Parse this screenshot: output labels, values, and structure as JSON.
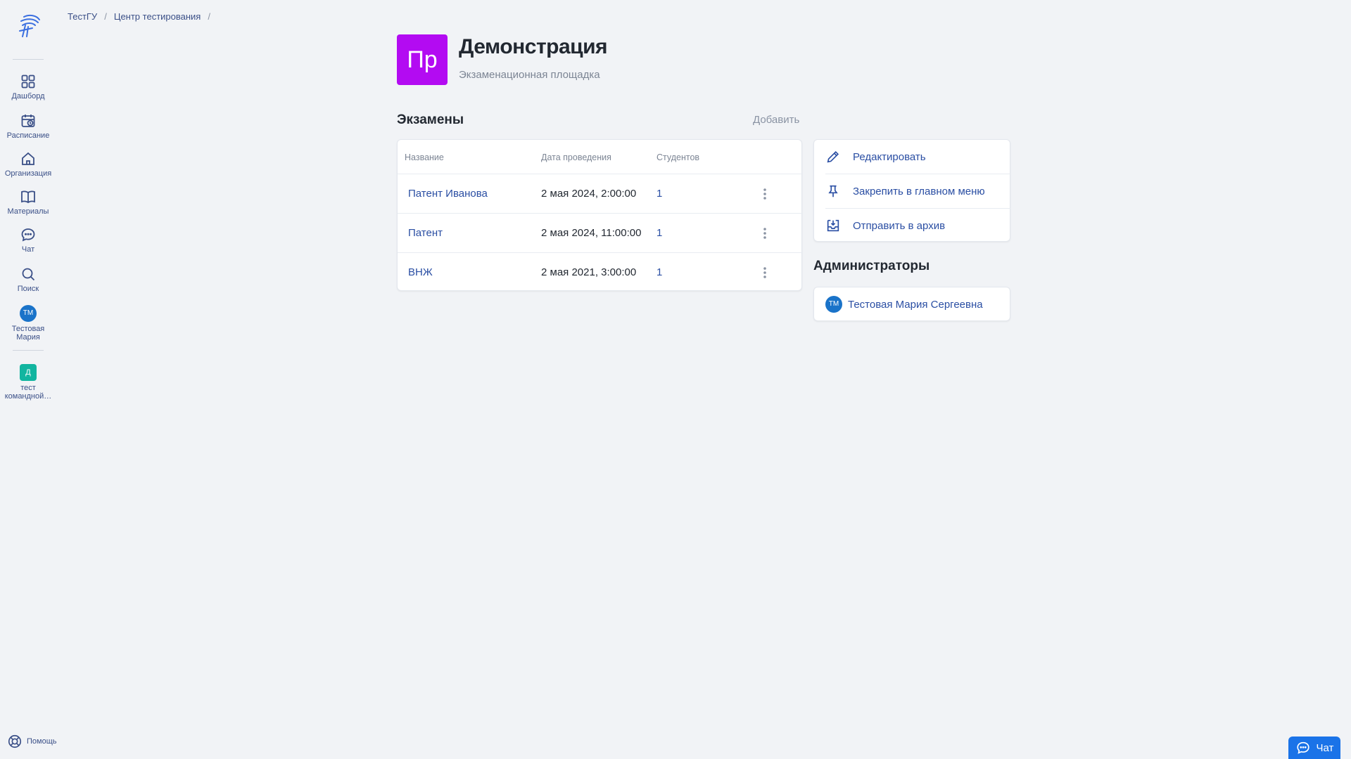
{
  "sidebar": {
    "items": [
      {
        "label": "Дашборд",
        "icon": "dashboard-icon"
      },
      {
        "label": "Расписание",
        "icon": "calendar-icon"
      },
      {
        "label": "Организация",
        "icon": "home-icon"
      },
      {
        "label": "Материалы",
        "icon": "book-icon"
      },
      {
        "label": "Чат",
        "icon": "chat-bubble-icon"
      },
      {
        "label": "Поиск",
        "icon": "search-icon"
      }
    ],
    "user": {
      "initials": "ТМ",
      "label_line1": "Тестовая",
      "label_line2": "Мария"
    },
    "team": {
      "initial": "Д",
      "label_line1": "тест",
      "label_line2": "командной…"
    },
    "help_label": "Помощь"
  },
  "breadcrumb": {
    "items": [
      "ТестГУ",
      "Центр тестирования"
    ],
    "separator": "/"
  },
  "header": {
    "avatar_text": "Пр",
    "avatar_color": "#b30bf2",
    "title": "Демонстрация",
    "subtitle": "Экзаменационная площадка"
  },
  "exams": {
    "section_title": "Экзамены",
    "add_label": "Добавить",
    "columns": [
      "Название",
      "Дата проведения",
      "Студентов"
    ],
    "rows": [
      {
        "name": "Патент Иванова",
        "date": "2 мая 2024, 2:00:00",
        "students": "1"
      },
      {
        "name": "Патент",
        "date": "2 мая 2024, 11:00:00",
        "students": "1"
      },
      {
        "name": "ВНЖ",
        "date": "2 мая 2021, 3:00:00",
        "students": "1"
      }
    ]
  },
  "actions": {
    "edit": "Редактировать",
    "pin": "Закрепить в главном меню",
    "archive": "Отправить в архив"
  },
  "admins": {
    "section_title": "Администраторы",
    "list": [
      {
        "initials": "ТМ",
        "name": "Тестовая Мария Сергеевна"
      }
    ]
  },
  "chat_button": {
    "label": "Чат"
  },
  "colors": {
    "accent": "#2a4ea3",
    "background": "#f1f3f6",
    "chat_button": "#1a73e8",
    "user_avatar": "#1a73c9",
    "team_badge": "#12b5a0"
  }
}
